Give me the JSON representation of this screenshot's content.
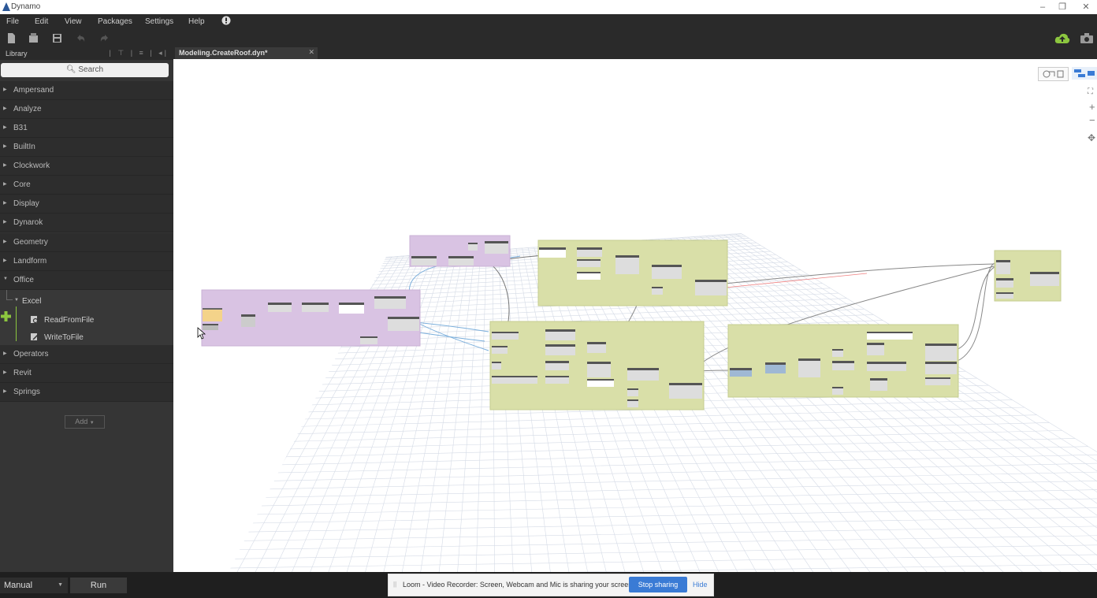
{
  "window": {
    "title": "Dynamo",
    "minimize": "–",
    "restore": "❐",
    "close": "✕"
  },
  "menu": [
    "File",
    "Edit",
    "View",
    "Packages",
    "Settings",
    "Help"
  ],
  "library": {
    "header": "Library",
    "search_placeholder": "Search",
    "categories_top": [
      "Ampersand",
      "Analyze",
      "B31",
      "BuiltIn",
      "Clockwork",
      "Core",
      "Display",
      "Dynarok",
      "Geometry",
      "Landform",
      "Office"
    ],
    "office_sub": {
      "group": "Excel",
      "items": [
        "ReadFromFile",
        "WriteToFile"
      ]
    },
    "categories_bottom": [
      "Operators",
      "Revit",
      "Springs"
    ],
    "add_label": "Add"
  },
  "tab": {
    "name": "Modeling.CreateRoof.dyn*"
  },
  "run": {
    "mode": "Manual",
    "run_label": "Run"
  },
  "loom": {
    "message": "Loom - Video Recorder: Screen, Webcam and Mic is sharing your screen.",
    "stop_label": "Stop sharing",
    "hide_label": "Hide"
  },
  "colors": {
    "group_purple": "#d9c3e3",
    "group_green": "#d9dfa8",
    "accent_blue": "#3a7bd5",
    "cloud_green": "#8cc63f"
  }
}
